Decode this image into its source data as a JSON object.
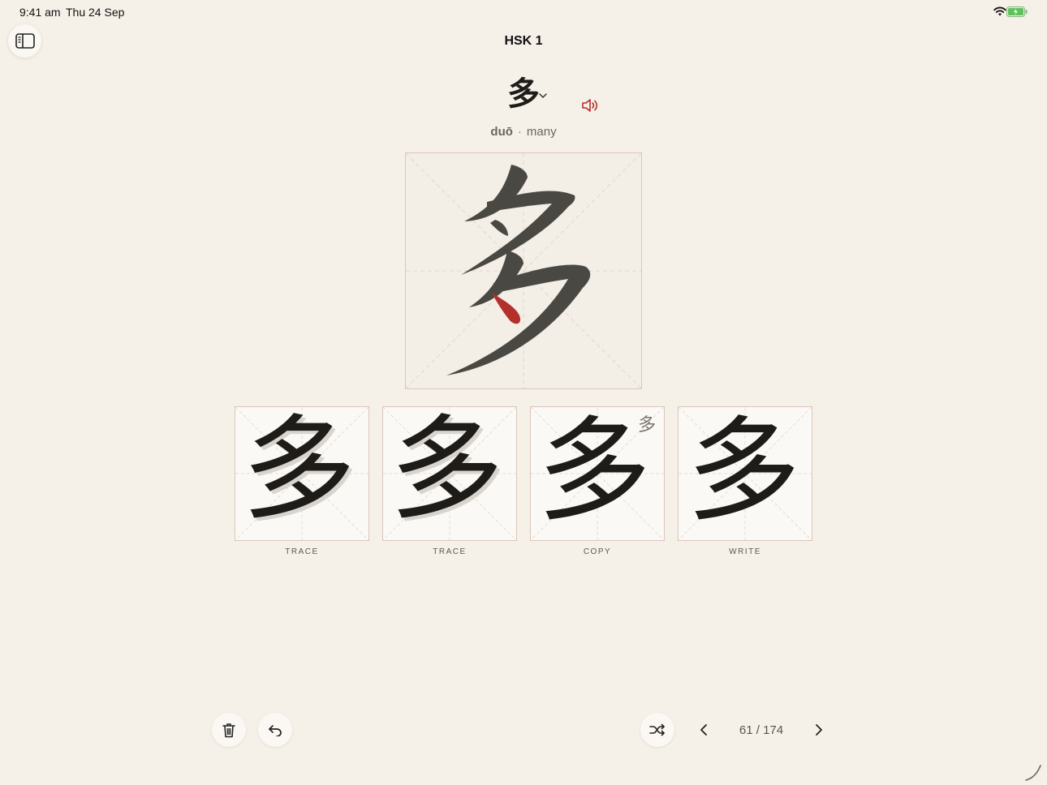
{
  "status": {
    "time": "9:41 am",
    "date": "Thu 24 Sep"
  },
  "header": {
    "title": "HSK 1"
  },
  "character": {
    "hanzi": "多",
    "pinyin": "duō",
    "separator": "·",
    "meaning": "many"
  },
  "stages": [
    {
      "label": "TRACE"
    },
    {
      "label": "TRACE"
    },
    {
      "label": "COPY",
      "hint": "多"
    },
    {
      "label": "WRITE"
    }
  ],
  "pager": {
    "counter": "61 / 174"
  },
  "icons": {
    "sidebar": "sidebar-toggle-icon",
    "dropdown": "chevron-down-icon",
    "speaker": "speaker-icon",
    "delete": "trash-icon",
    "undo": "undo-icon",
    "shuffle": "shuffle-icon",
    "prev": "chevron-left-icon",
    "next": "chevron-right-icon"
  },
  "colors": {
    "background": "#f5f0e8",
    "accent_red": "#b5302a",
    "stroke_dark": "#4a4842",
    "ink": "#1e1c19"
  }
}
